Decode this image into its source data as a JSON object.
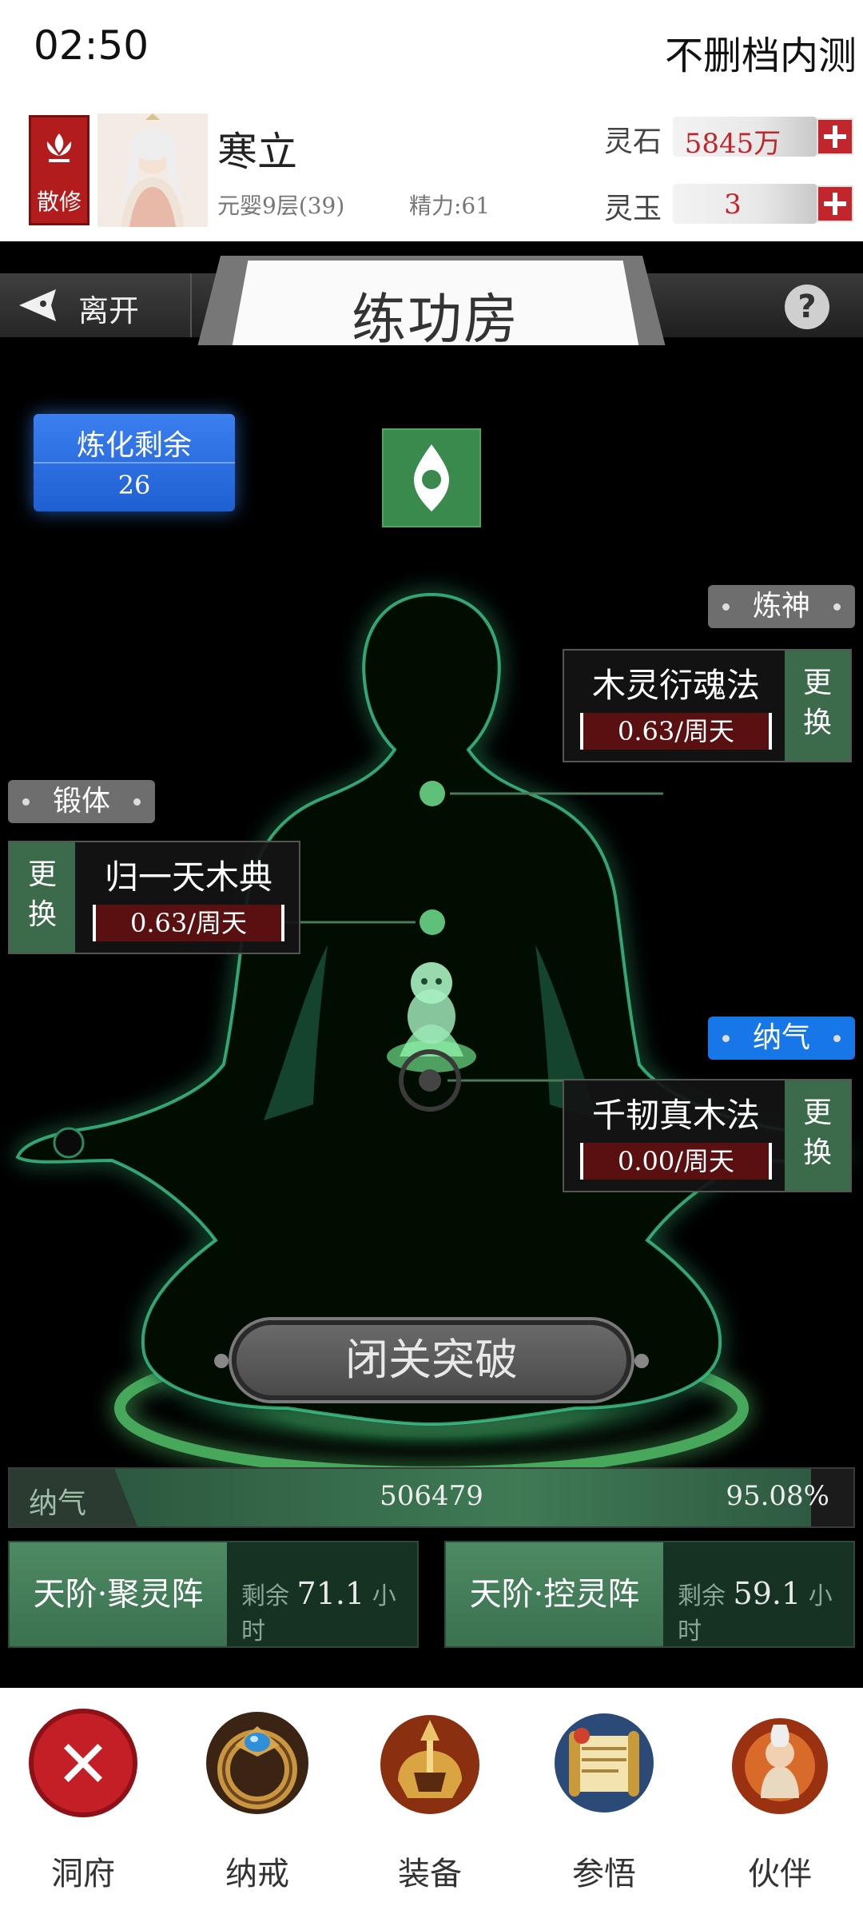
{
  "status_bar": {
    "time": "02:50",
    "right_text": "不删档内测"
  },
  "profile": {
    "sect_label": "散修",
    "name": "寒立",
    "realm": "元婴9层(39)",
    "energy": "精力:61",
    "currencies": [
      {
        "label": "灵石",
        "value": "5845万"
      },
      {
        "label": "灵玉",
        "value": "3"
      }
    ]
  },
  "title_bar": {
    "leave_label": "离开",
    "title": "练功房",
    "help_symbol": "?"
  },
  "refine": {
    "title": "炼化剩余",
    "value": "26"
  },
  "techniques": [
    {
      "tag": "炼神",
      "name": "木灵衍魂法",
      "rate": "0.63/周天",
      "swap": "更换"
    },
    {
      "tag": "锻体",
      "name": "归一天木典",
      "rate": "0.63/周天",
      "swap": "更换"
    },
    {
      "tag": "纳气",
      "name": "千韧真木法",
      "rate": "0.00/周天",
      "swap": "更换"
    }
  ],
  "breakthrough_label": "闭关突破",
  "qi": {
    "label": "纳气",
    "value": "506479",
    "percent": "95.08%",
    "fill_percent": 95.08
  },
  "arrays": [
    {
      "name": "天阶·聚灵阵",
      "remain_prefix": "剩余",
      "hours": "71.1",
      "unit": "小时"
    },
    {
      "name": "天阶·控灵阵",
      "remain_prefix": "剩余",
      "hours": "59.1",
      "unit": "小时"
    }
  ],
  "nav": [
    {
      "label": "洞府",
      "icon": "close-icon"
    },
    {
      "label": "纳戒",
      "icon": "ring-icon"
    },
    {
      "label": "装备",
      "icon": "helmet-icon"
    },
    {
      "label": "参悟",
      "icon": "scroll-icon"
    },
    {
      "label": "伙伴",
      "icon": "companion-icon"
    }
  ],
  "colors": {
    "accent_red": "#c0262b",
    "accent_blue": "#1877e8",
    "accent_green": "#3f7a55",
    "glow_green": "#4dffa0"
  }
}
